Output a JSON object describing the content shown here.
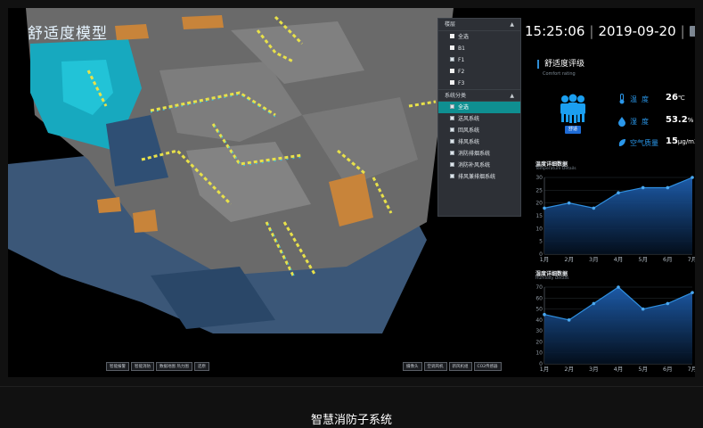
{
  "header": {
    "app_title": "舒适度模型",
    "time": "15:25:06",
    "date": "2019-09-20"
  },
  "floor_panel": {
    "floor_header": "楼层",
    "floors": [
      {
        "label": "全选",
        "checked": false
      },
      {
        "label": "B1",
        "checked": false
      },
      {
        "label": "F1",
        "checked": true
      },
      {
        "label": "F2",
        "checked": false
      },
      {
        "label": "F3",
        "checked": false
      }
    ],
    "system_header": "系统分类",
    "systems": [
      {
        "label": "全选",
        "checked": true,
        "active": true
      },
      {
        "label": "送风系统",
        "checked": true
      },
      {
        "label": "回风系统",
        "checked": true
      },
      {
        "label": "排风系统",
        "checked": true
      },
      {
        "label": "消防排烟系统",
        "checked": true
      },
      {
        "label": "消防补风系统",
        "checked": true
      },
      {
        "label": "排风兼排烟系统",
        "checked": true
      }
    ]
  },
  "comfort": {
    "title": "舒适度评级",
    "subtitle": "Comfort rating",
    "badge": "舒适",
    "temperature": {
      "label": "温度",
      "value": "26",
      "unit": "℃"
    },
    "humidity": {
      "label": "湿度",
      "value": "53.2",
      "unit": "%"
    },
    "air": {
      "label": "空气质量",
      "value": "15",
      "unit": "μg/m3"
    },
    "colors": {
      "accent": "#2a97ea",
      "badge": "#1e6bd6",
      "icon": "#1b9ff0"
    }
  },
  "temperature_chart": {
    "title": "温度详细数据",
    "subtitle": "Temperature Details"
  },
  "humidity_chart": {
    "title": "湿度详细数据",
    "subtitle": "Humidity Details"
  },
  "chart_data": [
    {
      "type": "area",
      "title": "温度详细数据",
      "categories": [
        "1月",
        "2月",
        "3月",
        "4月",
        "5月",
        "6月",
        "7月"
      ],
      "values": [
        18,
        20,
        18,
        24,
        26,
        26,
        30
      ],
      "yticks": [
        0,
        5,
        10,
        15,
        20,
        25,
        30
      ],
      "ylim": [
        0,
        30
      ],
      "grid": true,
      "colors": {
        "line": "#2f8fe0",
        "fill_top": "#1e5fb0",
        "fill_bottom": "#04101f"
      }
    },
    {
      "type": "area",
      "title": "湿度详细数据",
      "categories": [
        "1月",
        "2月",
        "3月",
        "4月",
        "5月",
        "6月",
        "7月"
      ],
      "values": [
        45,
        40,
        55,
        70,
        50,
        55,
        65
      ],
      "yticks": [
        0,
        10,
        20,
        30,
        40,
        50,
        60,
        70
      ],
      "ylim": [
        0,
        70
      ],
      "grid": true,
      "colors": {
        "line": "#2f8fe0",
        "fill_top": "#1e5fb0",
        "fill_bottom": "#04101f"
      }
    }
  ],
  "left_buttons": [
    "智能报警",
    "智能消防",
    "数据地图 热力图",
    "还原"
  ],
  "right_buttons": [
    "摄像头",
    "空调风机",
    "新风机组",
    "CO2传感器"
  ],
  "footer": {
    "title": "智慧消防子系统"
  }
}
